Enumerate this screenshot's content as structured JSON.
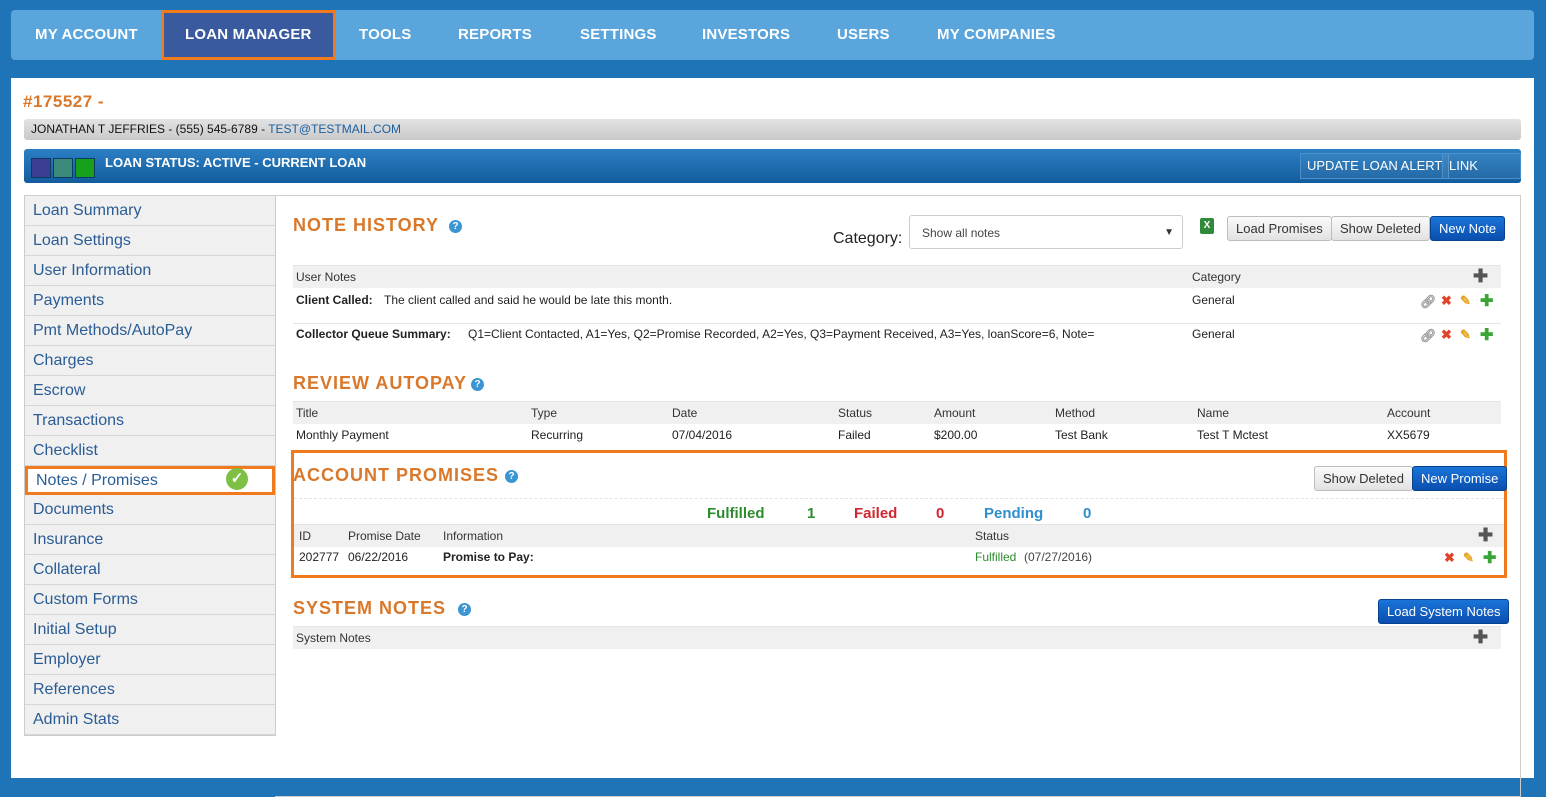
{
  "nav": {
    "items": [
      "MY ACCOUNT",
      "LOAN MANAGER",
      "TOOLS",
      "REPORTS",
      "SETTINGS",
      "INVESTORS",
      "USERS",
      "MY COMPANIES"
    ],
    "active": "LOAN MANAGER"
  },
  "loan": {
    "id": "#175527 -",
    "contact_name": "JONATHAN T JEFFRIES - (555) 545-6789 - ",
    "contact_email": "TEST@TESTMAIL.COM",
    "status": "LOAN STATUS: ACTIVE - CURRENT LOAN",
    "status_colors": [
      "#3c3f91",
      "#3c8a7c",
      "#16a01c"
    ],
    "update_alert_label": "UPDATE LOAN ALERT",
    "link_loan_label": "LINK LOAN"
  },
  "sidebar": {
    "items": [
      "Loan Summary",
      "Loan Settings",
      "User Information",
      "Payments",
      "Pmt Methods/AutoPay",
      "Charges",
      "Escrow",
      "Transactions",
      "Checklist",
      "Notes / Promises",
      "Documents",
      "Insurance",
      "Collateral",
      "Custom Forms",
      "Initial Setup",
      "Employer",
      "References",
      "Admin Stats"
    ],
    "active": "Notes / Promises"
  },
  "note_history": {
    "title": "NOTE HISTORY",
    "category_label": "Category:",
    "category_value": "Show all notes",
    "load_promises": "Load Promises",
    "show_deleted": "Show Deleted",
    "new_note": "New Note",
    "columns": [
      "User Notes",
      "Category"
    ],
    "rows": [
      {
        "label": "Client Called:",
        "text": "The client called and said he would be late this month.",
        "category": "General"
      },
      {
        "label": "Collector Queue Summary:",
        "text": "Q1=Client Contacted, A1=Yes, Q2=Promise Recorded, A2=Yes, Q3=Payment Received, A3=Yes, loanScore=6, Note=",
        "category": "General"
      }
    ]
  },
  "autopay": {
    "title": "REVIEW AUTOPAY",
    "columns": [
      "Title",
      "Type",
      "Date",
      "Status",
      "Amount",
      "Method",
      "Name",
      "Account"
    ],
    "row": [
      "Monthly Payment",
      "Recurring",
      "07/04/2016",
      "Failed",
      "$200.00",
      "Test Bank",
      "Test T Mctest",
      "XX5679"
    ]
  },
  "promises": {
    "title": "ACCOUNT PROMISES",
    "show_deleted": "Show Deleted",
    "new_promise": "New Promise",
    "fulfilled_label": "Fulfilled",
    "fulfilled_count": "1",
    "failed_label": "Failed",
    "failed_count": "0",
    "pending_label": "Pending",
    "pending_count": "0",
    "columns": [
      "ID",
      "Promise Date",
      "Information",
      "Status"
    ],
    "row": {
      "id": "202777",
      "date": "06/22/2016",
      "info": "Promise to Pay:",
      "status": "Fulfilled",
      "status_date": "(07/27/2016)"
    }
  },
  "system_notes": {
    "title": "SYSTEM NOTES",
    "load_label": "Load System Notes",
    "column": "System Notes"
  }
}
